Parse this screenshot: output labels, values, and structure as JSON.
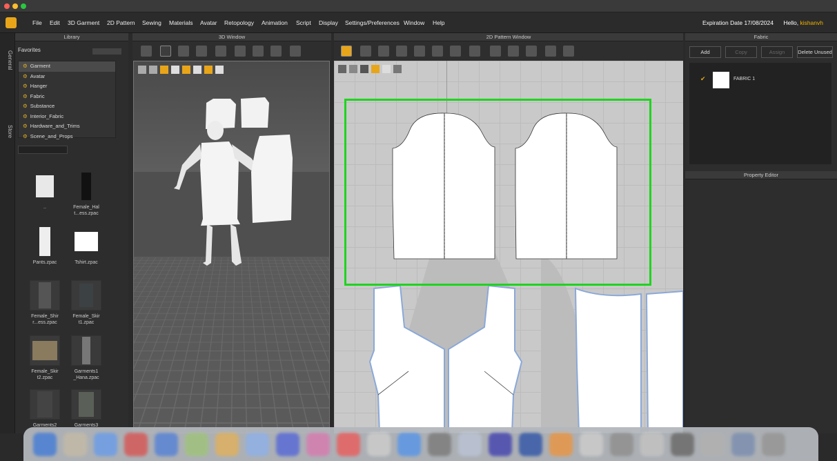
{
  "menubar": {
    "items": [
      "File",
      "Edit",
      "3D Garment",
      "2D Pattern",
      "Sewing",
      "Materials",
      "Avatar",
      "Retopology",
      "Animation",
      "Script",
      "Display",
      "Settings/Preferences",
      "Window",
      "Help"
    ],
    "expiration": "Expiration Date 17/08/2024",
    "hello_prefix": "Hello, ",
    "username": "kishanvh"
  },
  "left_tabs": [
    "General",
    "Store"
  ],
  "library": {
    "title": "Library",
    "favorites_label": "Favorites",
    "tree": [
      "Garment",
      "Avatar",
      "Hanger",
      "Fabric",
      "Substance",
      "Interior_Fabric",
      "Hardware_and_Trims",
      "Scene_and_Props"
    ],
    "thumbnails": [
      {
        "label": ".."
      },
      {
        "label": "Female_Hal t...ess.zpac"
      },
      {
        "label": "Pants.zpac"
      },
      {
        "label": "Tshirt.zpac"
      },
      {
        "label": "Female_Shir r...ess.zpac"
      },
      {
        "label": "Female_Skir t1.zpac"
      },
      {
        "label": "Female_Skir t2.zpac"
      },
      {
        "label": "Garments1 _Hana.zpac"
      },
      {
        "label": "Garments2"
      },
      {
        "label": "Garments3"
      }
    ]
  },
  "window_3d": {
    "title": "3D Window"
  },
  "window_2d": {
    "title": "2D Pattern Window"
  },
  "fabric": {
    "title": "Fabric",
    "buttons": {
      "add": "Add",
      "copy": "Copy",
      "assign": "Assign",
      "delete_unused": "Delete Unused"
    },
    "items": [
      {
        "name": "FABRIC 1"
      }
    ]
  },
  "property_editor": {
    "title": "Property Editor"
  },
  "colors": {
    "accent": "#e8a51a",
    "selection_box": "#1ed41e",
    "pattern_outline": "#8aa8d8",
    "viewport_2d": "#c9c9c9"
  }
}
